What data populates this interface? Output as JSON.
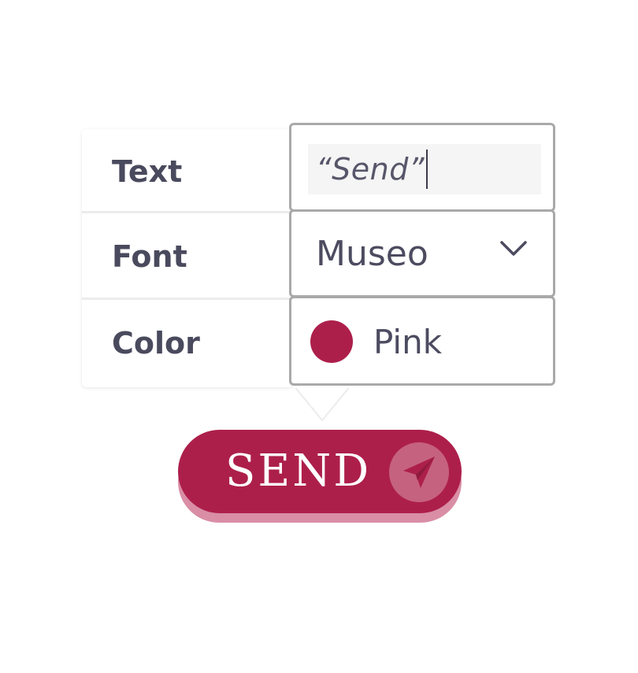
{
  "properties": {
    "text": {
      "label": "Text",
      "value": "“Send”"
    },
    "font": {
      "label": "Font",
      "value": "Museo"
    },
    "color": {
      "label": "Color",
      "value": "Pink",
      "swatch": "#ad1f4b"
    }
  },
  "button": {
    "label": "SEND",
    "icon": "paper-plane-icon",
    "color": "#ad1f4b"
  },
  "icons": {
    "dropdown": "chevron-down-icon"
  }
}
